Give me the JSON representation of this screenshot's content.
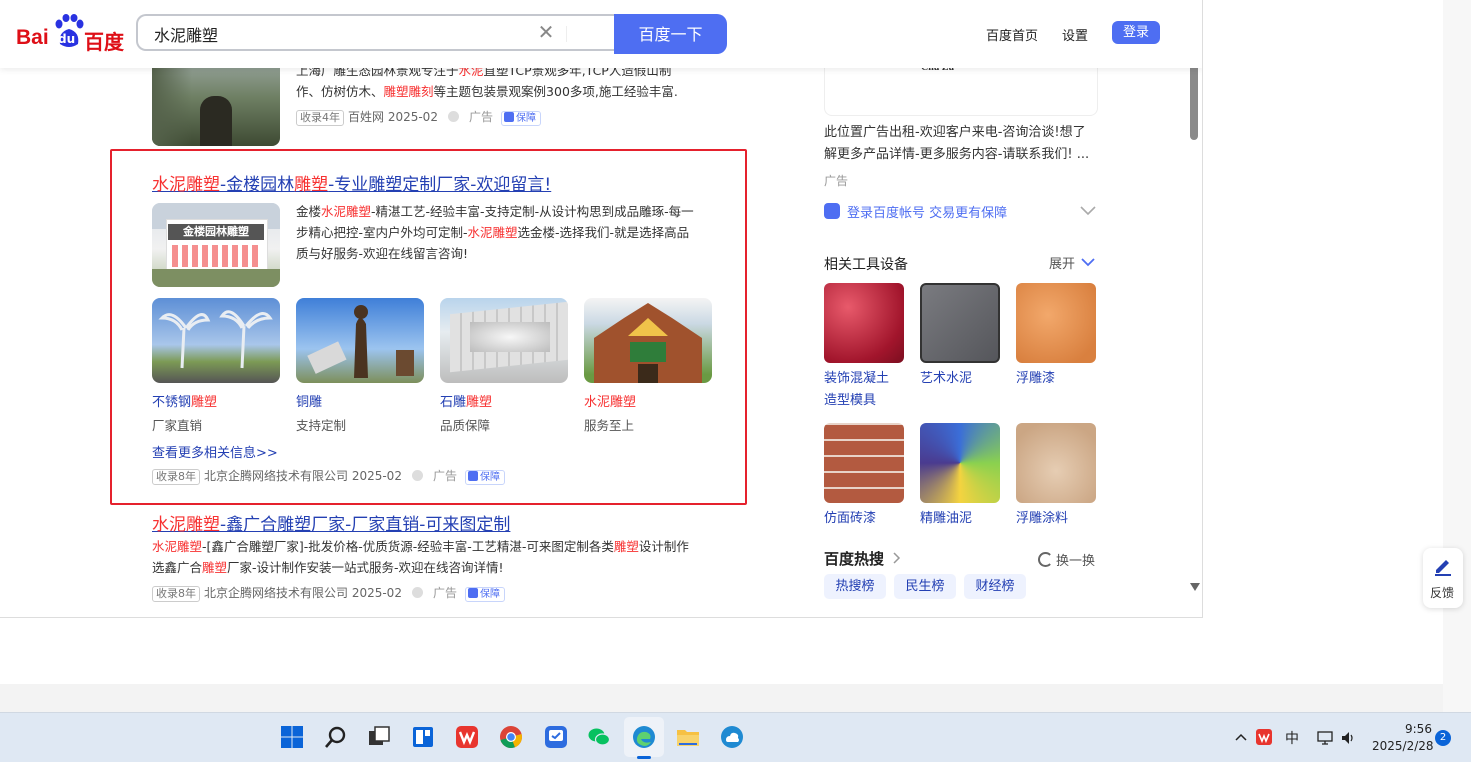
{
  "header": {
    "logo_bai": "Bai",
    "logo_du": "du",
    "logo_cn": "百度",
    "search_value": "水泥雕塑",
    "search_button": "百度一下",
    "links": [
      "百度首页",
      "设置"
    ],
    "login": "登录"
  },
  "results": {
    "prev": {
      "desc_line1_pre": "上海广雕生态园林景观专注于",
      "desc_line1_hl": "水泥",
      "desc_line1_post": "直塑TCP景观多年,TCP人造假山制",
      "desc_line2_pre": "作、仿树仿木、",
      "desc_line2_hl1": "雕塑",
      "desc_line2_hl2": "雕刻",
      "desc_line2_post": "等主题包装景观案例300多项,施工经验丰富.",
      "meta_tag": "收录4年",
      "meta_source": "百姓网 2025-02",
      "meta_ad": "广告",
      "meta_bao": "保障"
    },
    "main": {
      "title_parts": [
        "水泥雕塑",
        "-金楼园林",
        "雕塑",
        "-专业雕塑定制厂家-欢迎留言!"
      ],
      "thumb_caption": "金楼园林雕塑",
      "desc_l1_a": "金楼",
      "desc_l1_hl": "水泥雕塑",
      "desc_l1_b": "-精湛工艺-经验丰富-支持定制-从设计构思到成品雕琢-每一",
      "desc_l2_a": "步精心把控-室内户外均可定制-",
      "desc_l2_hl": "水泥雕塑",
      "desc_l2_b": "选金楼-选择我们-就是选择高品",
      "desc_l3": "质与好服务-欢迎在线留言咨询!",
      "subs": [
        {
          "label_a": "不锈钢",
          "label_hl": "雕塑",
          "desc": "厂家直销"
        },
        {
          "label_a": "铜雕",
          "label_hl": "",
          "desc": "支持定制"
        },
        {
          "label_a": "石雕",
          "label_hl": "雕塑",
          "desc": "品质保障"
        },
        {
          "label_a": "",
          "label_hl": "水泥雕塑",
          "desc": "服务至上"
        }
      ],
      "more": "查看更多相关信息>>",
      "meta_tag": "收录8年",
      "meta_source": "北京企腾网络技术有限公司 2025-02",
      "meta_ad": "广告",
      "meta_bao": "保障"
    },
    "next": {
      "title_hl1": "水泥雕塑",
      "title_b": "-鑫广合",
      "title_c": "雕塑厂家-厂家直销-可来图定制",
      "desc_l1_hl": "水泥雕塑",
      "desc_l1_b": "-[鑫广合雕塑厂家]-批发价格-优质货源-经验丰富-工艺精湛-可来图定制各类",
      "desc_l1_hl2": "雕塑",
      "desc_l1_c": "设计制作",
      "desc_l2_a": "选鑫广合",
      "desc_l2_hl": "雕塑",
      "desc_l2_b": "厂家-设计制作安装一站式服务-欢迎在线咨询详情!",
      "meta_tag": "收录8年",
      "meta_source": "北京企腾网络技术有限公司 2025-02",
      "meta_ad": "广告",
      "meta_bao": "保障"
    }
  },
  "sidebar": {
    "ad_card_text": "Chu Zu",
    "ad_text_l1": "此位置广告出租-欢迎客户来电-咨询洽谈!想了",
    "ad_text_l2": "解更多产品详情-更多服务内容-请联系我们! ...",
    "ad_label": "广告",
    "login_prompt": "登录百度帐号 交易更有保障",
    "tools_title": "相关工具设备",
    "tools_expand": "展开",
    "tools": [
      {
        "label_l1": "装饰混凝土",
        "label_l2": "造型模具"
      },
      {
        "label_l1": "艺术水泥",
        "label_l2": ""
      },
      {
        "label_l1": "浮雕漆",
        "label_l2": ""
      },
      {
        "label_l1": "仿面砖漆",
        "label_l2": ""
      },
      {
        "label_l1": "精雕油泥",
        "label_l2": ""
      },
      {
        "label_l1": "浮雕涂料",
        "label_l2": ""
      }
    ],
    "hot_title": "百度热搜",
    "hot_refresh": "换一换",
    "hot_tabs": [
      "热搜榜",
      "民生榜",
      "财经榜"
    ]
  },
  "feedback": {
    "label": "反馈"
  },
  "taskbar": {
    "ime": "中",
    "time": "9:56",
    "date": "2025/2/28",
    "notif_count": "2"
  },
  "colors": {
    "accent": "#4e6ef2",
    "link": "#2440b3",
    "highlight": "#f73131",
    "annotation_box": "#e5212d"
  }
}
